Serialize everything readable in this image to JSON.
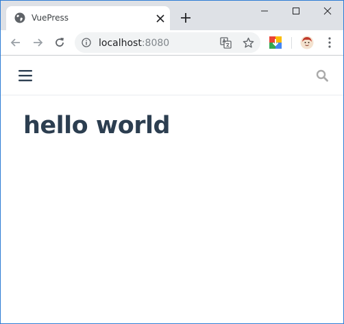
{
  "browser": {
    "tab": {
      "title": "VuePress"
    },
    "address_bar": {
      "host": "localhost",
      "port": ":8080"
    }
  },
  "page": {
    "heading": "hello world"
  },
  "colors": {
    "heading": "#2c3e50",
    "window_border": "#2b7bd4",
    "tabstrip": "#dee1e6"
  }
}
